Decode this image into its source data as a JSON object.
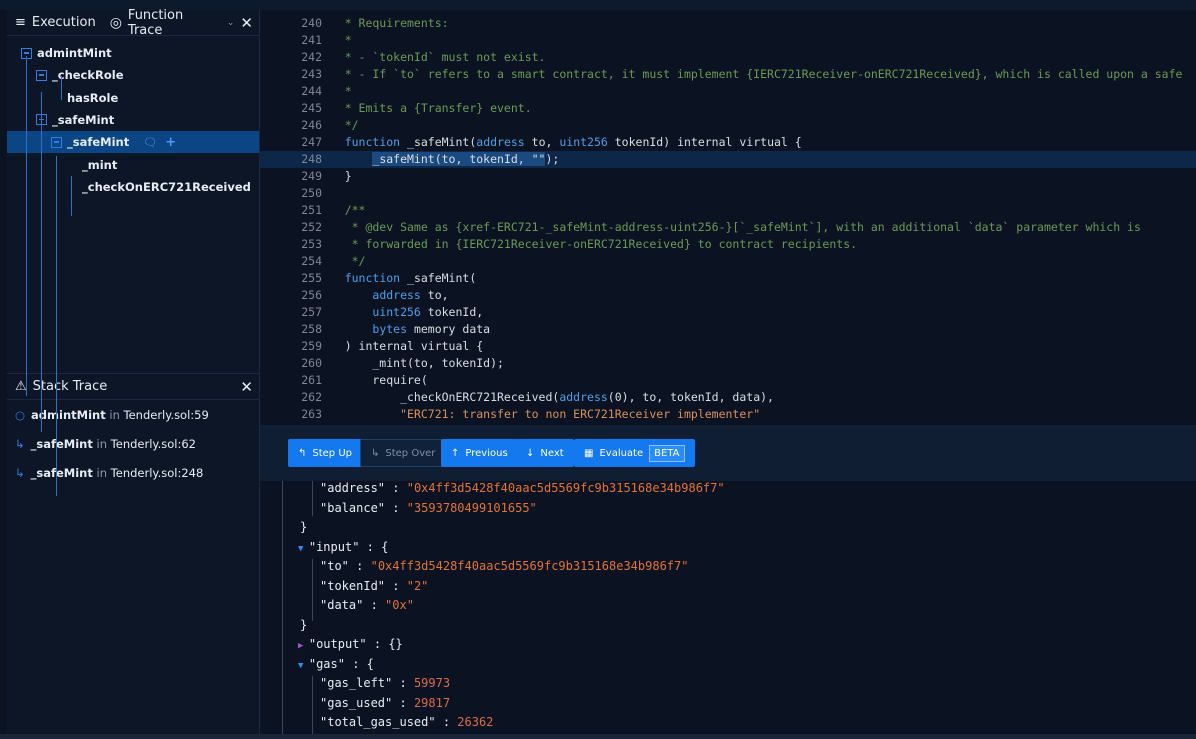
{
  "execution": {
    "tab_label": "Execution",
    "mode_label": "Function Trace"
  },
  "tree": [
    {
      "label": "admintMint",
      "depth": 0,
      "expanded": true
    },
    {
      "label": "_checkRole",
      "depth": 1,
      "expanded": true
    },
    {
      "label": "hasRole",
      "depth": 2
    },
    {
      "label": "_safeMint",
      "depth": 1,
      "expanded": true
    },
    {
      "label": "_safeMint",
      "depth": 2,
      "expanded": true,
      "selected": true
    },
    {
      "label": "_mint",
      "depth": 3
    },
    {
      "label": "_checkOnERC721Received",
      "depth": 3
    }
  ],
  "stack_trace": {
    "title": "Stack Trace",
    "items": [
      {
        "fn": "admintMint",
        "in": "in",
        "loc": "Tenderly.sol:59",
        "icon": "circle-icon"
      },
      {
        "fn": "_safeMint",
        "in": "in",
        "loc": "Tenderly.sol:62",
        "icon": "return-arrow-icon"
      },
      {
        "fn": "_safeMint",
        "in": "in",
        "loc": "Tenderly.sol:248",
        "icon": "return-arrow-icon"
      }
    ]
  },
  "code": {
    "highlight_line": 248,
    "lines": [
      {
        "n": 240,
        "t": [
          [
            "c",
            "    * Requirements:"
          ]
        ]
      },
      {
        "n": 241,
        "t": [
          [
            "c",
            "    *"
          ]
        ]
      },
      {
        "n": 242,
        "t": [
          [
            "c",
            "    * - `tokenId` must not exist."
          ]
        ]
      },
      {
        "n": 243,
        "t": [
          [
            "c",
            "    * - If `to` refers to a smart contract, it must implement {IERC721Receiver-onERC721Received}, which is called upon a safe"
          ]
        ]
      },
      {
        "n": 244,
        "t": [
          [
            "c",
            "    *"
          ]
        ]
      },
      {
        "n": 245,
        "t": [
          [
            "c",
            "    * Emits a {Transfer} event."
          ]
        ]
      },
      {
        "n": 246,
        "t": [
          [
            "c",
            "    */"
          ]
        ]
      },
      {
        "n": 247,
        "t": [
          [
            "",
            "    "
          ],
          [
            "k",
            "function"
          ],
          [
            "",
            " _safeMint("
          ],
          [
            "k",
            "address"
          ],
          [
            "",
            " to, "
          ],
          [
            "k",
            "uint256"
          ],
          [
            "",
            " tokenId) internal virtual {"
          ]
        ]
      },
      {
        "n": 248,
        "t": [
          [
            "",
            "        "
          ],
          [
            "sel",
            "_safeMint(to, tokenId, \"\""
          ],
          [
            "",
            ");"
          ]
        ]
      },
      {
        "n": 249,
        "t": [
          [
            "",
            "    }"
          ]
        ]
      },
      {
        "n": 250,
        "t": []
      },
      {
        "n": 251,
        "t": [
          [
            "c",
            "    /**"
          ]
        ]
      },
      {
        "n": 252,
        "t": [
          [
            "c",
            "     * @dev Same as {xref-ERC721-_safeMint-address-uint256-}[`_safeMint`], with an additional `data` parameter which is"
          ]
        ]
      },
      {
        "n": 253,
        "t": [
          [
            "c",
            "     * forwarded in {IERC721Receiver-onERC721Received} to contract recipients."
          ]
        ]
      },
      {
        "n": 254,
        "t": [
          [
            "c",
            "     */"
          ]
        ]
      },
      {
        "n": 255,
        "t": [
          [
            "",
            "    "
          ],
          [
            "k",
            "function"
          ],
          [
            "",
            " _safeMint("
          ]
        ]
      },
      {
        "n": 256,
        "t": [
          [
            "",
            "        "
          ],
          [
            "k",
            "address"
          ],
          [
            "",
            " to,"
          ]
        ]
      },
      {
        "n": 257,
        "t": [
          [
            "",
            "        "
          ],
          [
            "k",
            "uint256"
          ],
          [
            "",
            " tokenId,"
          ]
        ]
      },
      {
        "n": 258,
        "t": [
          [
            "",
            "        "
          ],
          [
            "k",
            "bytes"
          ],
          [
            "",
            " memory data"
          ]
        ]
      },
      {
        "n": 259,
        "t": [
          [
            "",
            "    ) internal virtual {"
          ]
        ]
      },
      {
        "n": 260,
        "t": [
          [
            "",
            "        _mint(to, tokenId);"
          ]
        ]
      },
      {
        "n": 261,
        "t": [
          [
            "",
            "        require("
          ]
        ]
      },
      {
        "n": 262,
        "t": [
          [
            "",
            "            _checkOnERC721Received("
          ],
          [
            "k",
            "address"
          ],
          [
            "",
            "(0), to, tokenId, data),"
          ]
        ]
      },
      {
        "n": 263,
        "t": [
          [
            "",
            "            "
          ],
          [
            "s",
            "\"ERC721: transfer to non ERC721Receiver implementer\""
          ]
        ]
      }
    ]
  },
  "toolbar": {
    "step_up": "Step Up",
    "step_over": "Step Over",
    "previous": "Previous",
    "next": "Next",
    "evaluate": "Evaluate",
    "beta": "BETA"
  },
  "json_view": [
    {
      "indent": 2,
      "key": "\"address\"",
      "val": "\"0x4ff3d5428f40aac5d5569fc9b315168e34b986f7\"",
      "vt": "s"
    },
    {
      "indent": 2,
      "key": "\"balance\"",
      "val": "\"3593780499101655\"",
      "vt": "s"
    },
    {
      "indent": 1,
      "raw": "}"
    },
    {
      "indent": 1,
      "tri": "down",
      "key": "\"input\"",
      "val": "{",
      "vt": ""
    },
    {
      "indent": 2,
      "key": "\"to\"",
      "val": "\"0x4ff3d5428f40aac5d5569fc9b315168e34b986f7\"",
      "vt": "s"
    },
    {
      "indent": 2,
      "key": "\"tokenId\"",
      "val": "\"2\"",
      "vt": "s"
    },
    {
      "indent": 2,
      "key": "\"data\"",
      "val": "\"0x\"",
      "vt": "s"
    },
    {
      "indent": 1,
      "raw": "}"
    },
    {
      "indent": 1,
      "tri": "right",
      "key": "\"output\"",
      "val": "{}",
      "vt": ""
    },
    {
      "indent": 1,
      "tri": "down",
      "key": "\"gas\"",
      "val": "{",
      "vt": ""
    },
    {
      "indent": 2,
      "key": "\"gas_left\"",
      "val": "59973",
      "vt": "n"
    },
    {
      "indent": 2,
      "key": "\"gas_used\"",
      "val": "29817",
      "vt": "n"
    },
    {
      "indent": 2,
      "key": "\"total_gas_used\"",
      "val": "26362",
      "vt": "n"
    }
  ]
}
